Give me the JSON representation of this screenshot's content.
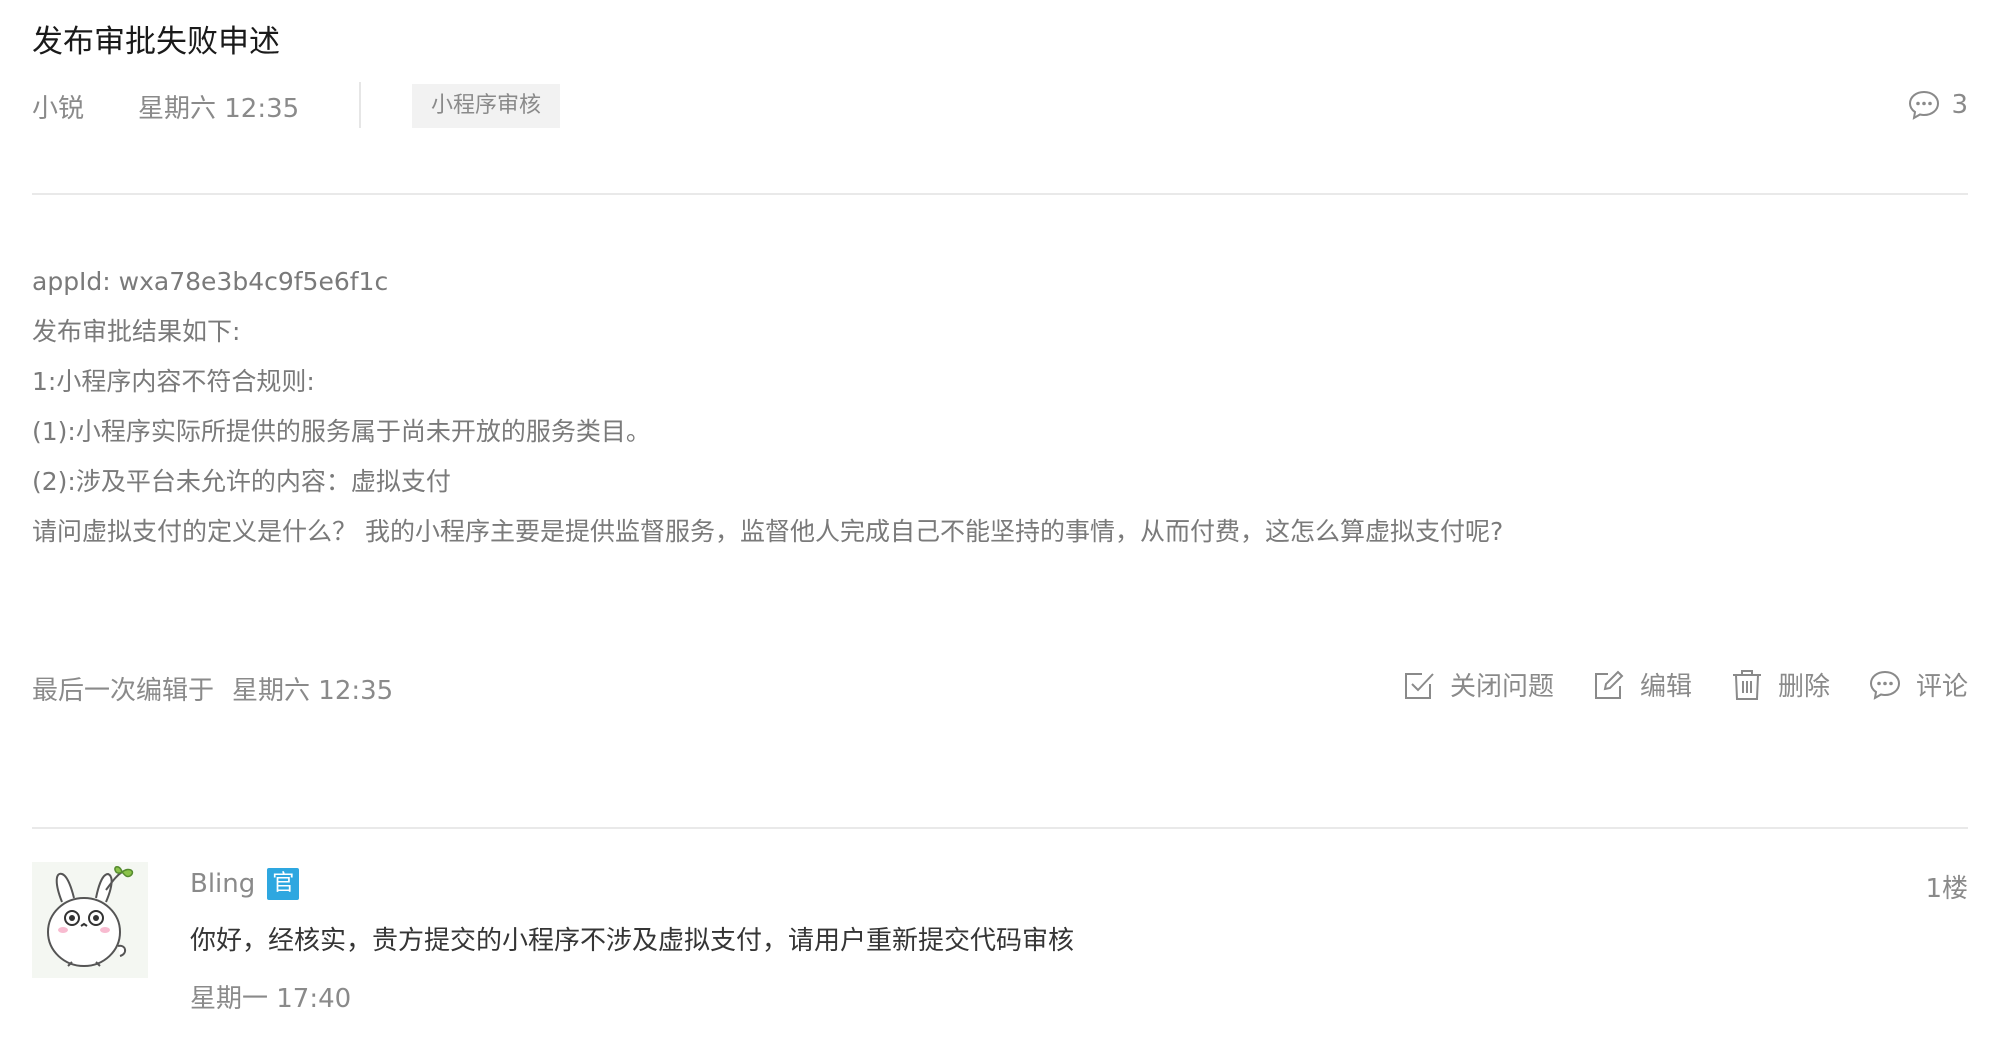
{
  "post": {
    "title": "发布审批失败申述",
    "author": "小锐",
    "time": "星期六 12:35",
    "tag": "小程序审核",
    "comment_count": "3",
    "body_lines": [
      "appId: wxa78e3b4c9f5e6f1c",
      "发布审批结果如下:",
      "1:小程序内容不符合规则:",
      "(1):小程序实际所提供的服务属于尚未开放的服务类目。",
      "(2):涉及平台未允许的内容：虚拟支付",
      "请问虚拟支付的定义是什么？ 我的小程序主要是提供监督服务，监督他人完成自己不能坚持的事情，从而付费，这怎么算虚拟支付呢?"
    ],
    "last_edited_label": "最后一次编辑于",
    "last_edited_time": "星期六 12:35"
  },
  "actions": {
    "close": "关闭问题",
    "edit": "编辑",
    "delete": "删除",
    "comment": "评论"
  },
  "icons": {
    "comment_count": "comment-bubble-icon",
    "close": "checkbox-icon",
    "edit": "edit-pencil-icon",
    "delete": "trash-icon",
    "comment": "comment-bubble-icon"
  },
  "reply": {
    "name": "Bling",
    "badge": "官",
    "floor": "1楼",
    "content": "你好，经核实，贵方提交的小程序不涉及虚拟支付，请用户重新提交代码审核",
    "time": "星期一 17:40"
  },
  "colors": {
    "badge": "#2ea7e0",
    "muted_text": "#8a8a8a",
    "divider": "#e9e9e9"
  }
}
